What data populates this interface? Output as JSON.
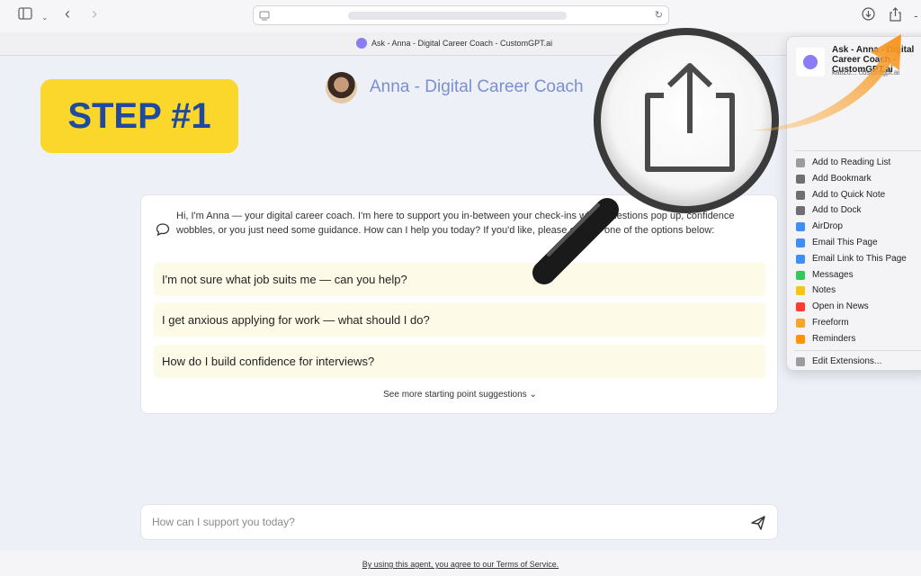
{
  "browser": {
    "tab_title": "Ask - Anna - Digital Career Coach - CustomGPT.ai",
    "url": ""
  },
  "agent": {
    "name": "Anna - Digital Career Coach"
  },
  "badge": {
    "text": "STEP #1"
  },
  "chat": {
    "greeting": "Hi, I'm Anna — your digital career coach. I'm here to support you in-between your check-ins when questions pop up, confidence wobbles, or you just need some guidance. How can I help you today? If you'd like, please choose one of the options below:",
    "suggestions": [
      "I'm not sure what job suits me — can you help?",
      "I get anxious applying for work — what should I do?",
      "How do I build confidence for interviews?"
    ],
    "see_more": "See more starting point suggestions"
  },
  "input": {
    "placeholder": "How can I support you today?"
  },
  "footer": {
    "text": "By using this agent, you agree to our Terms of Service."
  },
  "share_menu": {
    "title": "Ask - Anna - Digital Career Coach - CustomGPT.ai",
    "url": "katizo... customgpt.ai",
    "items": [
      {
        "label": "Add to Reading List",
        "icon": "reading-list-icon",
        "color": "#9b9ba0"
      },
      {
        "label": "Add Bookmark",
        "icon": "book-icon",
        "color": "#6e6e73"
      },
      {
        "label": "Add to Quick Note",
        "icon": "quick-note-icon",
        "color": "#6e6e73"
      },
      {
        "label": "Add to Dock",
        "icon": "dock-icon",
        "color": "#6e6e73"
      },
      {
        "label": "AirDrop",
        "icon": "airdrop-icon",
        "color": "#3d8ef7"
      },
      {
        "label": "Email This Page",
        "icon": "mail-icon",
        "color": "#3d8ef7"
      },
      {
        "label": "Email Link to This Page",
        "icon": "mail-icon",
        "color": "#3d8ef7"
      },
      {
        "label": "Messages",
        "icon": "messages-icon",
        "color": "#34c759"
      },
      {
        "label": "Notes",
        "icon": "notes-icon",
        "color": "#f5c518"
      },
      {
        "label": "Open in News",
        "icon": "news-icon",
        "color": "#ff3b30"
      },
      {
        "label": "Freeform",
        "icon": "freeform-icon",
        "color": "#f5a623"
      },
      {
        "label": "Reminders",
        "icon": "reminders-icon",
        "color": "#ff9500"
      }
    ],
    "edit": "Edit Extensions..."
  },
  "colors": {
    "badge_bg": "#fcd72b",
    "badge_text": "#1f4a9e",
    "agent_name": "#7a8fd0",
    "arrow": "#f7931e",
    "suggestion_bg": "#fdfbe8"
  }
}
